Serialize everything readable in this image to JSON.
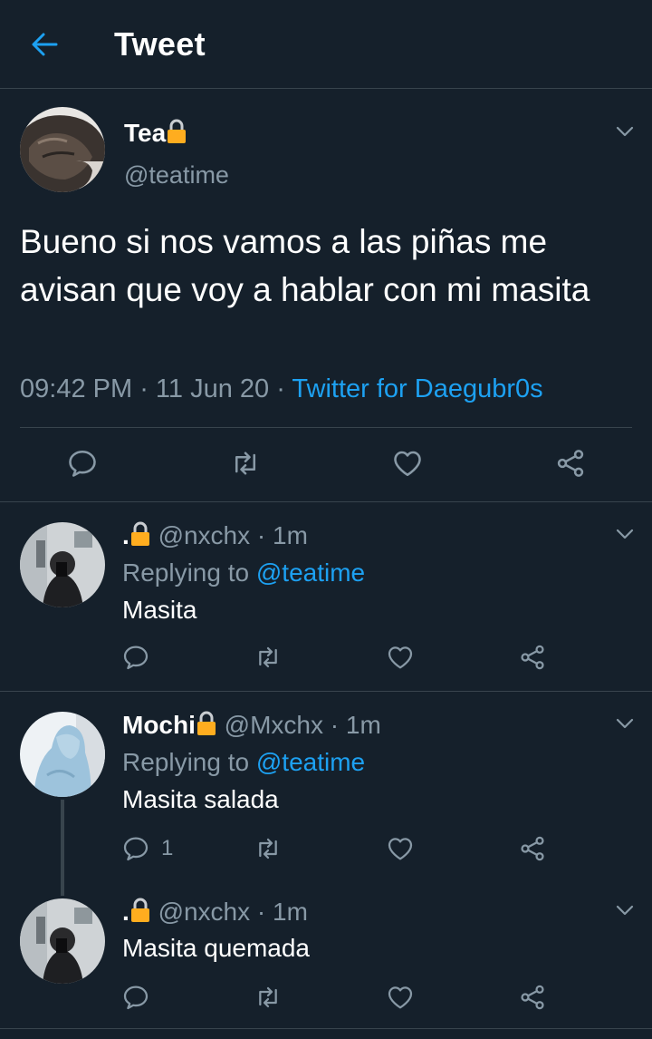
{
  "header": {
    "title": "Tweet"
  },
  "main_tweet": {
    "name": "Tea",
    "handle": "@teatime",
    "text": "Bueno si nos vamos a las piñas me avisan que voy a hablar con mi masita",
    "time": "09:42 PM",
    "sep1": " · ",
    "date": "11 Jun 20",
    "sep2": " · ",
    "source": "Twitter for Daegubr0s"
  },
  "replies": [
    {
      "name": ".",
      "handle": "@nxchx",
      "dot": " · ",
      "time": "1m",
      "replying_prefix": "Replying to ",
      "replying_to": "@teatime",
      "text": "Masita",
      "reply_count": ""
    },
    {
      "name": "Mochi",
      "handle": "@Mxchx",
      "dot": " · ",
      "time": "1m",
      "replying_prefix": "Replying to ",
      "replying_to": "@teatime",
      "text": "Masita salada",
      "reply_count": "1"
    },
    {
      "name": ".",
      "handle": "@nxchx",
      "dot": " · ",
      "time": "1m",
      "text": "Masita quemada",
      "reply_count": ""
    }
  ],
  "colors": {
    "background": "#15202b",
    "accent": "#1da1f2",
    "secondary_text": "#8899a6",
    "border": "#38444d",
    "lock": "#ffad1f"
  },
  "icons": [
    "back-arrow-icon",
    "lock-icon",
    "chevron-down-icon",
    "reply-icon",
    "retweet-icon",
    "like-icon",
    "share-icon"
  ]
}
